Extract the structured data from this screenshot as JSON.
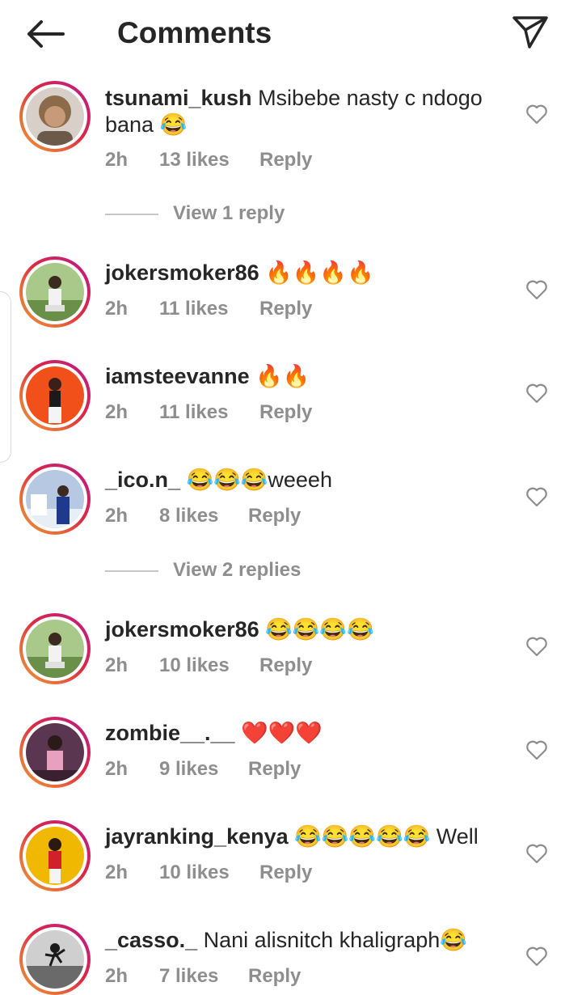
{
  "header": {
    "title": "Comments",
    "back_icon": "arrow-left-icon",
    "send_icon": "paper-plane-icon"
  },
  "comments": [
    {
      "username": "tsunami_kush",
      "text": " Msibebe nasty c ndogo bana 😂",
      "time": "2h",
      "likes": "13 likes",
      "reply": "Reply",
      "avatar_color": "#c9b8a8"
    },
    {
      "username": "jokersmoker86",
      "text": " 🔥🔥🔥🔥",
      "time": "2h",
      "likes": "11 likes",
      "reply": "Reply",
      "avatar_color": "#7fa85a"
    },
    {
      "username": "iamsteevanne",
      "text": " 🔥🔥",
      "time": "2h",
      "likes": "11 likes",
      "reply": "Reply",
      "avatar_color": "#f2501a"
    },
    {
      "username": "_ico.n_",
      "text": " 😂😂😂weeeh",
      "time": "2h",
      "likes": "8 likes",
      "reply": "Reply",
      "avatar_color": "#9bb3d4"
    },
    {
      "username": "jokersmoker86",
      "text": " 😂😂😂😂",
      "time": "2h",
      "likes": "10 likes",
      "reply": "Reply",
      "avatar_color": "#7fa85a"
    },
    {
      "username": "zombie__.__",
      "text": " ❤️❤️❤️",
      "time": "2h",
      "likes": "9 likes",
      "reply": "Reply",
      "avatar_color": "#6b3a5c"
    },
    {
      "username": "jayranking_kenya",
      "text": " 😂😂😂😂😂 Well",
      "time": "2h",
      "likes": "10 likes",
      "reply": "Reply",
      "avatar_color": "#f0b800"
    },
    {
      "username": "_casso._",
      "text": " Nani alisnitch khaligraph😂",
      "time": "2h",
      "likes": "7 likes",
      "reply": "Reply",
      "avatar_color": "#8a8a8a"
    }
  ],
  "view_replies": [
    {
      "label": "View 1 reply"
    },
    {
      "label": "View 2 replies"
    }
  ],
  "colors": {
    "accent_ring": "#dc2743",
    "meta": "#8e8e8e"
  }
}
